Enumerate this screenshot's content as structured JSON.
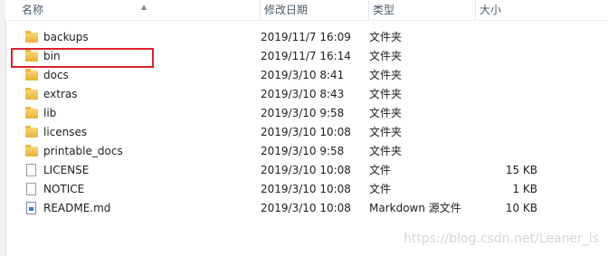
{
  "columns": {
    "name": "名称",
    "date": "修改日期",
    "type": "类型",
    "size": "大小"
  },
  "rows": [
    {
      "icon": "folder-icon",
      "name": "backups",
      "date": "2019/11/7 16:09",
      "type": "文件夹",
      "size": ""
    },
    {
      "icon": "folder-icon",
      "name": "bin",
      "date": "2019/11/7 16:14",
      "type": "文件夹",
      "size": ""
    },
    {
      "icon": "folder-icon",
      "name": "docs",
      "date": "2019/3/10 8:41",
      "type": "文件夹",
      "size": ""
    },
    {
      "icon": "folder-icon",
      "name": "extras",
      "date": "2019/3/10 8:43",
      "type": "文件夹",
      "size": ""
    },
    {
      "icon": "folder-icon",
      "name": "lib",
      "date": "2019/3/10 9:58",
      "type": "文件夹",
      "size": ""
    },
    {
      "icon": "folder-icon",
      "name": "licenses",
      "date": "2019/3/10 10:08",
      "type": "文件夹",
      "size": ""
    },
    {
      "icon": "folder-icon",
      "name": "printable_docs",
      "date": "2019/3/10 9:58",
      "type": "文件夹",
      "size": ""
    },
    {
      "icon": "file-icon",
      "name": "LICENSE",
      "date": "2019/3/10 10:08",
      "type": "文件",
      "size": "15 KB"
    },
    {
      "icon": "file-icon",
      "name": "NOTICE",
      "date": "2019/3/10 10:08",
      "type": "文件",
      "size": "1 KB"
    },
    {
      "icon": "markdown-file-icon",
      "name": "README.md",
      "date": "2019/3/10 10:08",
      "type": "Markdown 源文件",
      "size": "10 KB"
    }
  ],
  "watermark": "https://blog.csdn.net/Leaner_ls",
  "colors": {
    "highlight": "#d9222a",
    "folder": "#f0c24b"
  }
}
